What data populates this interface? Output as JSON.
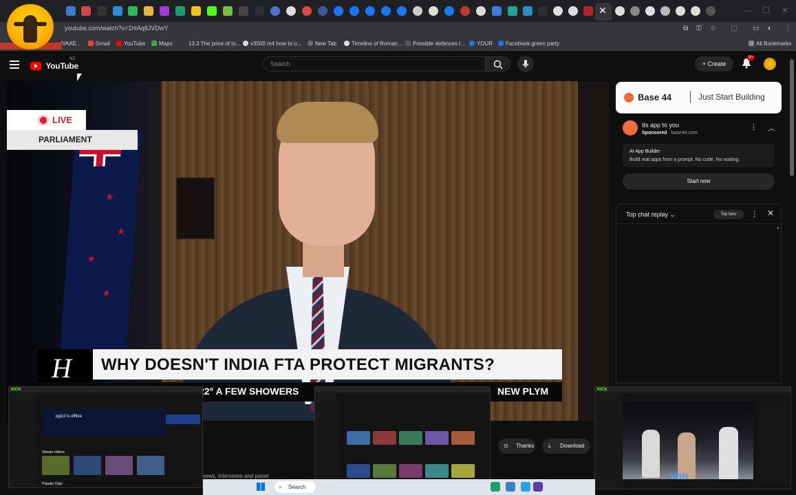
{
  "browser": {
    "url": "youtube.com/watch?v=1hIAq8JVDwY",
    "bookmarks": [
      "IVAAE...",
      "Gmail",
      "YouTube",
      "Maps",
      "13.3 The price of to...",
      "x3500 m4 how to u...",
      "New Tab",
      "Timeline of Roman...",
      "Possible defences t...",
      "YOUR",
      "Facebook green party"
    ],
    "all_bookmarks": "All Bookmarks"
  },
  "youtube": {
    "logo_text": "YouTube",
    "country_code": "NZ",
    "search_placeholder": "Search",
    "create_label": "Create",
    "notification_count": "9+"
  },
  "video": {
    "live_label": "LIVE",
    "live_sub": "PARLIAMENT",
    "headline": "WHY DOESN'T INDIA FTA PROTECT MIGRANTS?",
    "ticker_weather": "22° A FEW SHOWERS",
    "ticker_town": "NEW PLYM"
  },
  "ad": {
    "brand": "Base 44",
    "slogan": "Just Start Building",
    "title": "Its app to you",
    "sponsored": "Sponsored",
    "domain": "base44.com",
    "desc_title": "AI App Builder",
    "desc_body": "Build real apps from a prompt. No code. No waiting.",
    "cta": "Start now"
  },
  "chat": {
    "title": "Top chat replay",
    "fans_label": "Top fans"
  },
  "actions": {
    "thanks": "Thanks",
    "download": "Download"
  },
  "description_snippet": "news, interviews and panel",
  "thumbnails": {
    "kick_logo": "KICK",
    "kick_status": "pgiz2 is offline",
    "stream_videos": "Stream Videos",
    "popular_clips": "Popular Clips",
    "fight_caption": "WIN"
  },
  "taskbar": {
    "search_label": "Search"
  },
  "colors": {
    "youtube_red": "#ff0000",
    "live_red": "#d1202f",
    "kick_green": "#53fc18",
    "brand_orange": "#f26b3a"
  }
}
